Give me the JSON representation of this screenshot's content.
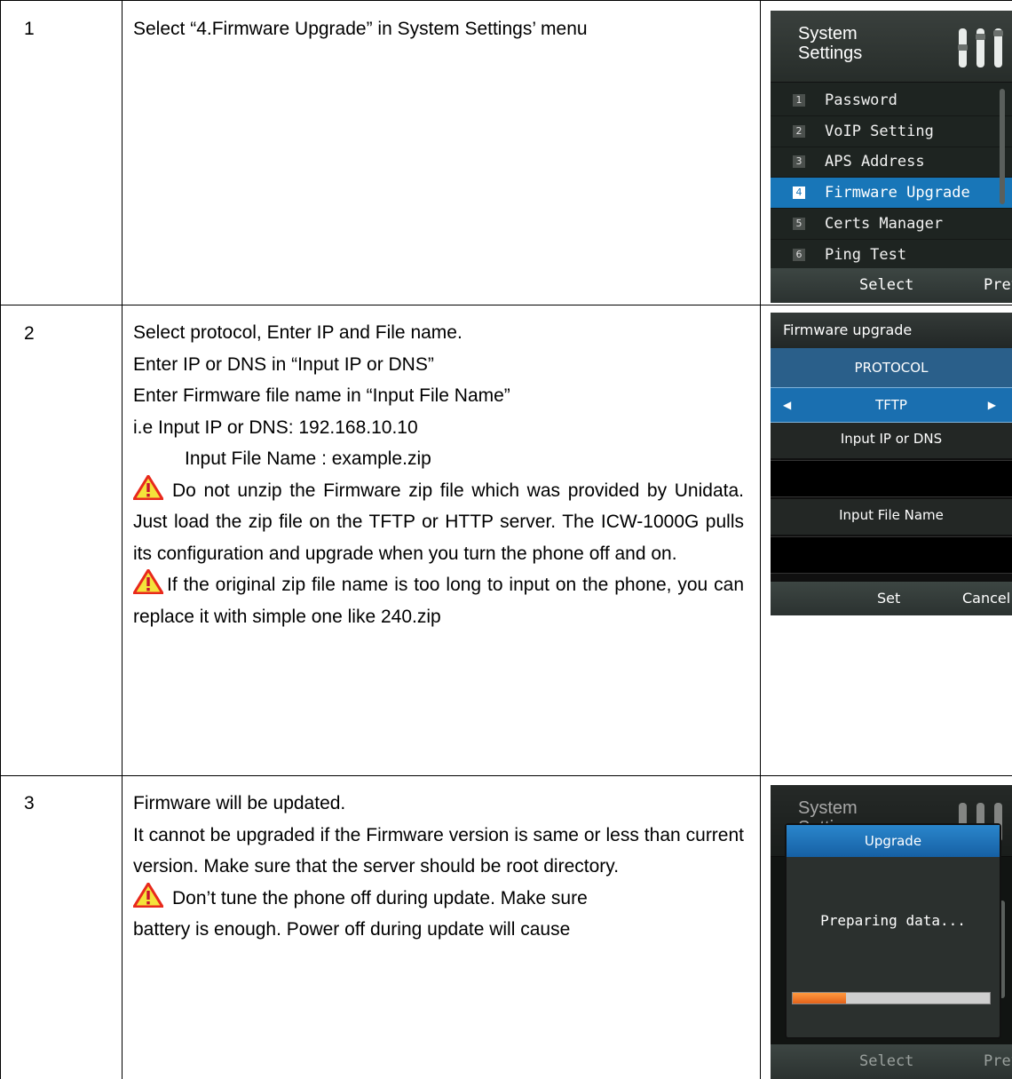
{
  "rows": [
    {
      "num": "1",
      "text": "Select “4.Firmware Upgrade” in System Settings’ menu"
    },
    {
      "num": "2",
      "lines": [
        "Select protocol, Enter IP and File name.",
        "Enter IP or DNS in “Input IP or DNS”",
        "Enter Firmware file name in “Input File Name”",
        "i.e    Input IP or DNS: 192.168.10.10",
        "Input File Name : example.zip"
      ],
      "warning1": "Do not unzip the Firmware zip file which was provided by Unidata. Just load the zip file on the TFTP or HTTP server. The ICW-1000G pulls its configuration and upgrade when you turn the phone off and on.",
      "warning2": "If the original zip file name is too long to input on the phone, you can replace it with simple one like 240.zip"
    },
    {
      "num": "3",
      "line1": "Firmware will be updated.",
      "para": "It cannot be upgraded if the Firmware version is same or less than current version. Make sure that the server should be root directory.",
      "warning": "Don’t tune the phone off during update. Make sure",
      "tail": " battery is enough. Power off during update will cause"
    }
  ],
  "screen1": {
    "title_line1": "System",
    "title_line2": "Settings",
    "menu": [
      {
        "n": "1",
        "label": "Password"
      },
      {
        "n": "2",
        "label": "VoIP Setting"
      },
      {
        "n": "3",
        "label": "APS Address"
      },
      {
        "n": "4",
        "label": "Firmware Upgrade"
      },
      {
        "n": "5",
        "label": "Certs Manager"
      },
      {
        "n": "6",
        "label": "Ping Test"
      }
    ],
    "selected_index": 3,
    "soft_left": "Select",
    "soft_right": "Prev"
  },
  "screen2": {
    "title": "Firmware upgrade",
    "protocol_label": "PROTOCOL",
    "protocol_value": "TFTP",
    "ip_label": "Input IP or DNS",
    "file_label": "Input File Name",
    "soft_left": "Set",
    "soft_right": "Cancel"
  },
  "screen3": {
    "title_line1": "System",
    "title_line2": "Settings",
    "dialog_title": "Upgrade",
    "message": "Preparing data...",
    "progress": 0.27,
    "soft_left": "Select",
    "soft_right": "Prev"
  },
  "colors": {
    "highlight": "#1876b8",
    "progress": "#f07a2a",
    "warning": "#e8291c"
  }
}
